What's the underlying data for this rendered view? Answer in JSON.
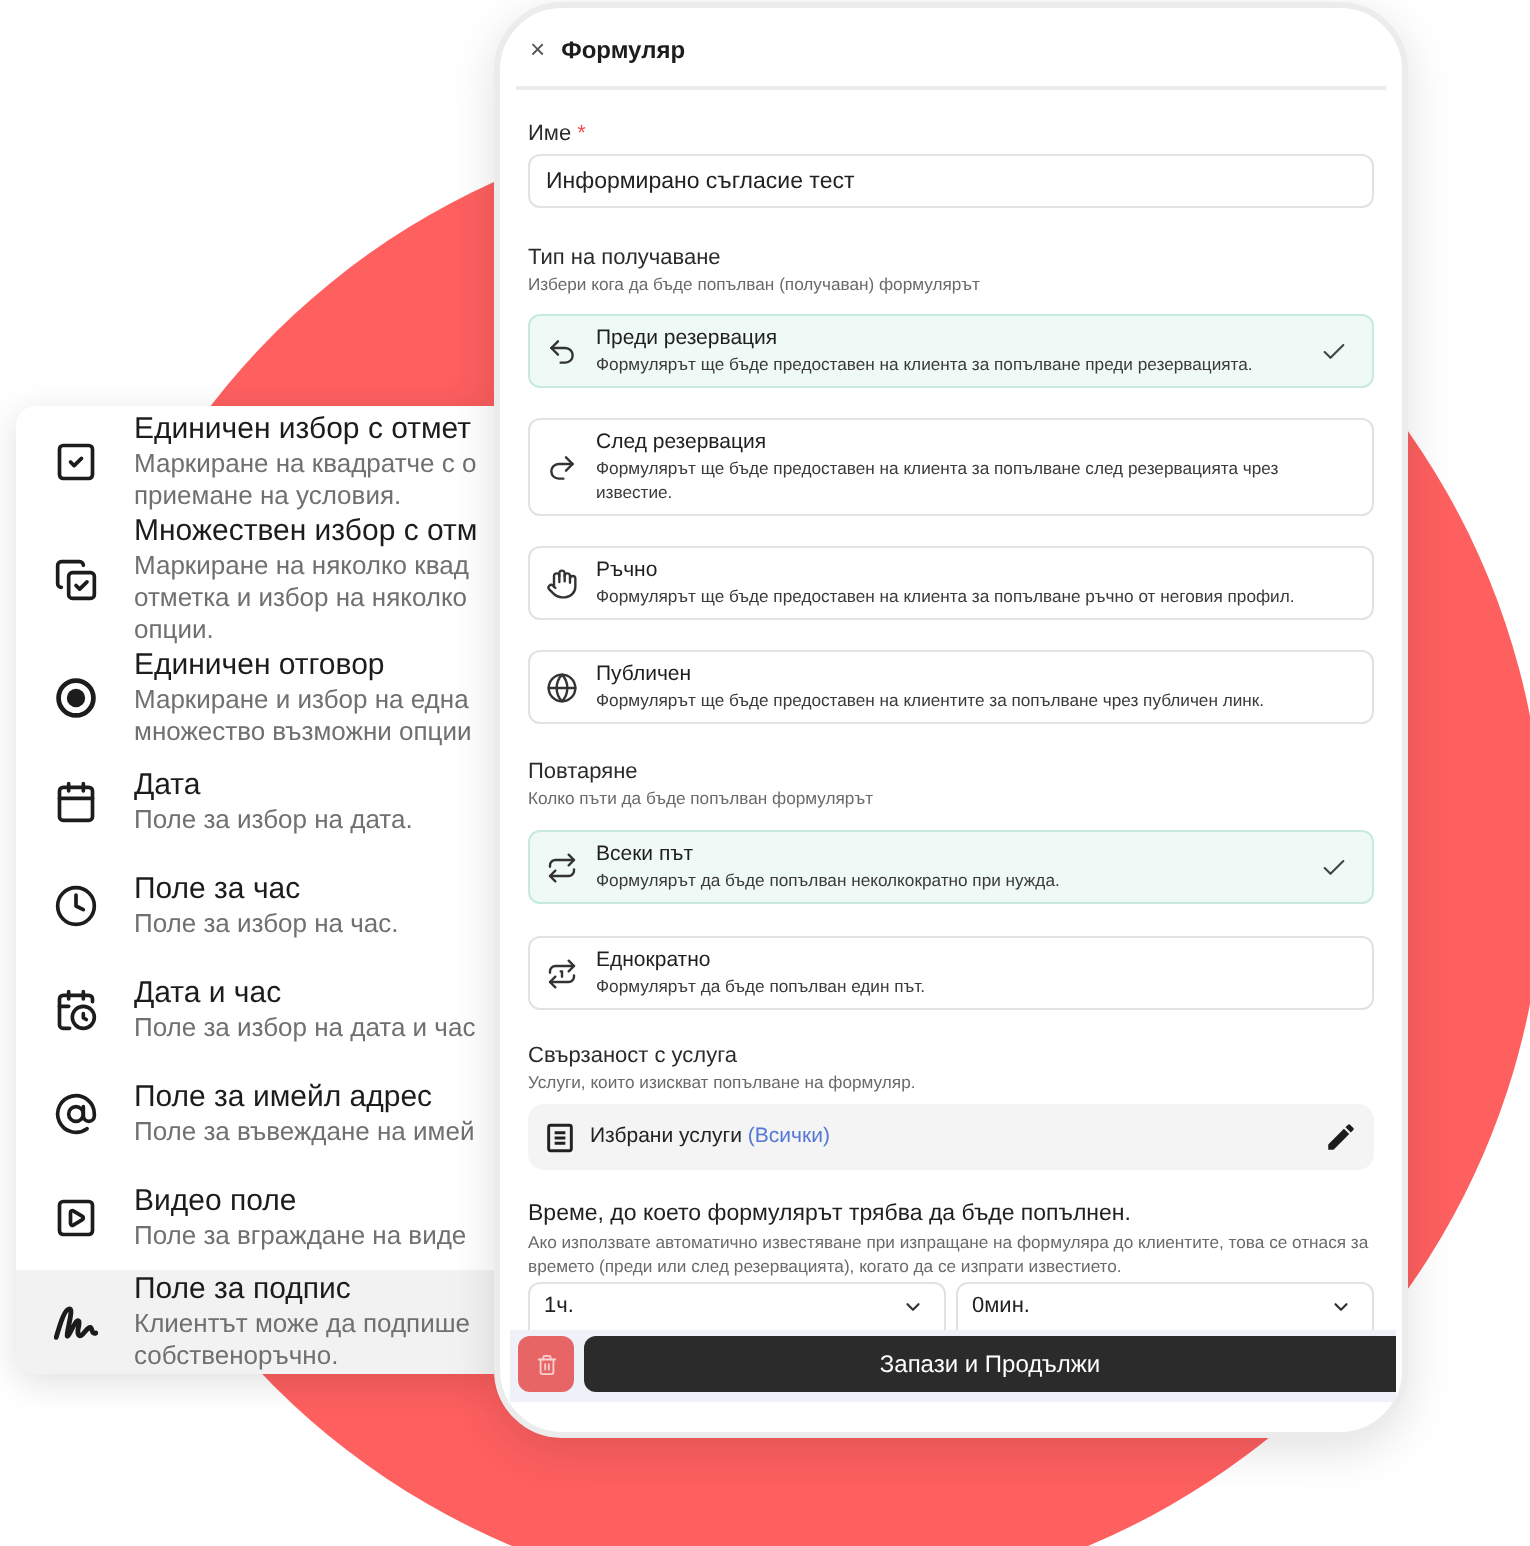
{
  "field_types_menu": {
    "items": [
      {
        "title": "Единичен избор с отмет",
        "description_lines": [
          "Маркиране на квадратче с о",
          "приемане на условия."
        ],
        "selected": false
      },
      {
        "title": "Множествен избор с отм",
        "description_lines": [
          "Маркиране на няколко квад",
          "отметка и избор на няколко",
          "опции."
        ],
        "selected": false
      },
      {
        "title": "Единичен отговор",
        "description_lines": [
          "Маркиране и избор на една",
          "множество възможни опции"
        ],
        "selected": false
      },
      {
        "title": "Дата",
        "description_lines": [
          "Поле за избор на дата."
        ],
        "selected": false
      },
      {
        "title": "Поле за час",
        "description_lines": [
          "Поле за избор на час."
        ],
        "selected": false
      },
      {
        "title": "Дата и час",
        "description_lines": [
          "Поле за избор на дата и час"
        ],
        "selected": false
      },
      {
        "title": "Поле за имейл адрес",
        "description_lines": [
          "Поле за въвеждане на имей"
        ],
        "selected": false
      },
      {
        "title": "Видео поле",
        "description_lines": [
          "Поле за вграждане на виде"
        ],
        "selected": false
      },
      {
        "title": "Поле за подпис",
        "description_lines": [
          "Клиентът може да подпише",
          "собственоръчно."
        ],
        "selected": true
      }
    ]
  },
  "form": {
    "close_label": "×",
    "title": "Формуляр",
    "name": {
      "label": "Име",
      "required_mark": "*",
      "value": "Информирано съгласие тест"
    },
    "receive_type": {
      "label": "Тип на получаване",
      "hint": "Избери кога да бъде попълван (получаван) формулярът",
      "options": [
        {
          "title": "Преди резервация",
          "description": "Формулярът ще бъде предоставен на клиента за попълване преди резервацията.",
          "selected": true
        },
        {
          "title": "След резервация",
          "description": "Формулярът ще бъде предоставен на клиента за попълване след резервацията чрез известие.",
          "selected": false
        },
        {
          "title": "Ръчно",
          "description": "Формулярът ще бъде предоставен на клиента за попълване ръчно от неговия профил.",
          "selected": false
        },
        {
          "title": "Публичен",
          "description": "Формулярът ще бъде предоставен на клиентите за попълване чрез публичен линк.",
          "selected": false
        }
      ]
    },
    "repeat": {
      "label": "Повтаряне",
      "hint": "Колко пъти да бъде попълван формулярът",
      "options": [
        {
          "title": "Всеки път",
          "description": "Формулярът да бъде попълван неколкократно при нужда.",
          "selected": true
        },
        {
          "title": "Еднократно",
          "description": "Формулярът да бъде попълван един път.",
          "selected": false
        }
      ]
    },
    "service_link": {
      "label": "Свързаност с услуга",
      "hint": "Услуги, които изискват попълване на формуляр.",
      "value": "Избрани услуги",
      "link": "(Всички)"
    },
    "deadline": {
      "label": "Време, до което формулярът трябва да бъде попълнен.",
      "hint": "Ако използвате автоматично известяване при изпращане на формуляра до клиентите, това се отнася за времето (преди или след резервацията), когато да се изпрати известието.",
      "selects": [
        {
          "value": "1ч."
        },
        {
          "value": "0мин."
        }
      ]
    },
    "footer": {
      "save_button": "Запази и Продължи"
    }
  }
}
